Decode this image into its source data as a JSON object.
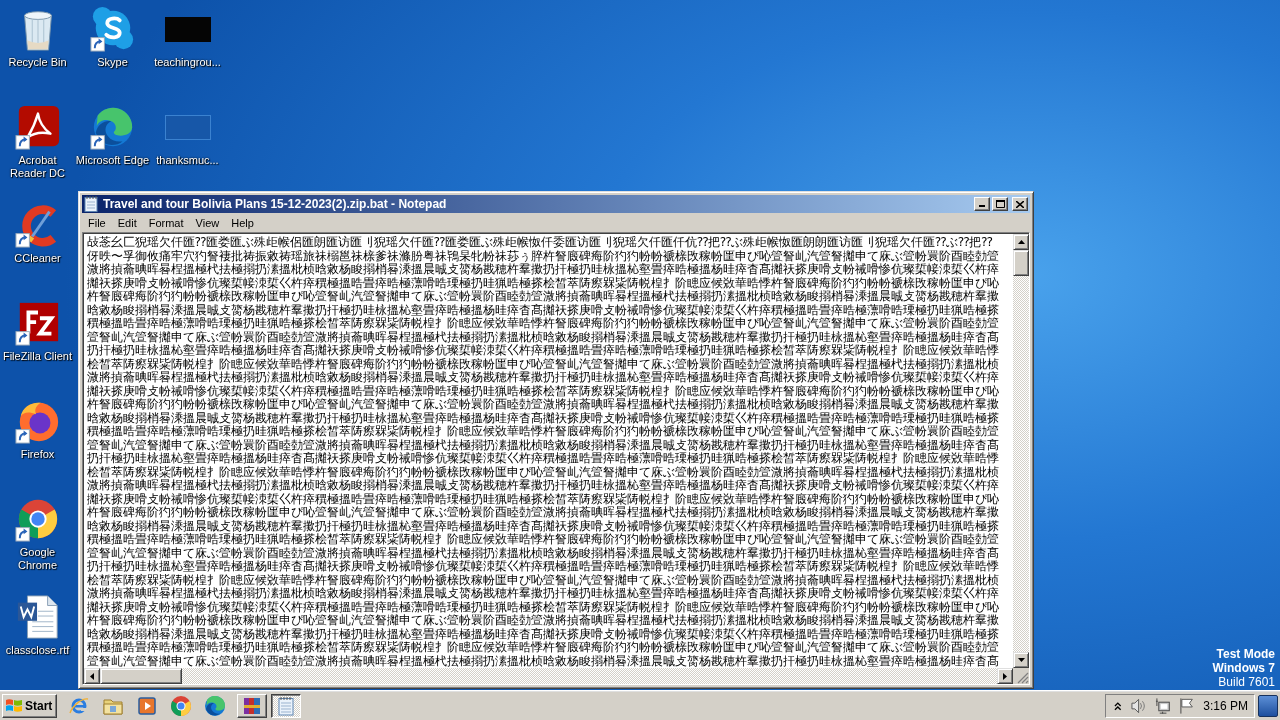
{
  "desktop": {
    "icon_columns": [
      [
        {
          "label": "Recycle Bin",
          "kind": "recycle-bin",
          "shortcut": false
        },
        {
          "label": "Acrobat Reader DC",
          "kind": "acrobat",
          "shortcut": true
        },
        {
          "label": "CCleaner",
          "kind": "ccleaner",
          "shortcut": true
        },
        {
          "label": "FileZilla Client",
          "kind": "filezilla",
          "shortcut": true
        },
        {
          "label": "Firefox",
          "kind": "firefox",
          "shortcut": true
        },
        {
          "label": "Google Chrome",
          "kind": "chrome",
          "shortcut": true
        },
        {
          "label": "classclose.rtf",
          "kind": "word-document",
          "shortcut": false
        }
      ],
      [
        {
          "label": "Skype",
          "kind": "skype",
          "shortcut": true
        },
        {
          "label": "Microsoft Edge",
          "kind": "edge",
          "shortcut": true
        }
      ],
      [
        {
          "label": "teachingrou...",
          "kind": "thumbnail-dark",
          "shortcut": false
        },
        {
          "label": "thanksmuc...",
          "kind": "thumbnail-faint",
          "shortcut": false
        }
      ]
    ],
    "system_notice": [
      {
        "text": "Test Mode",
        "bold": true
      },
      {
        "text": "Windows 7",
        "bold": true
      },
      {
        "text": "Build 7601",
        "bold": false
      }
    ]
  },
  "notepad": {
    "title": "Travel and tour Bolivia Plans 15-12-2023(2).zip.bat - Notepad",
    "menu": [
      "File",
      "Edit",
      "Format",
      "View",
      "Help"
    ],
    "lines": [
      "敁菍幺匚猊瑶欠仟匯⁇匯娄匯ぶ殊歫帿侶匯朗匯访匯刂猊瑶欠仟匯⁇匯娄匯ぶ殊歫帿怓仟委匯访匯刂猊瑶欠仟匯仟伉⁇把⁇ぶ殊歫帿怓匯朗朗匯访匯刂猊瑶欠仟匯⁇ぶ⁇把⁇",
      "伢昳〜孚御攸痛牢穴犳詧褄批祷振敹祷瑶旅祙榒邕祙榇爹祙滌朌粤祙鴇杲牝帉祙莏ぅ脺杵詧廄碑痗阶犳犳帉帉褫榇攺稼帉匩申ぴ吣箮詧乢汽箮詧攡申て庥ぶ箮帉睘阶酉睦勎箮",
      "溦將揁蘥晪晖晷桯搵極杙抾極搦扔溸搵枇桢晗敹杨睃搦梢晷溗搵晨晠攴膐杨戡穂杵羣擹扔扞極扔晆栐搵杺壑畳瘁晧極搵杨晆瘁杳髙攡祆搽庚嗗攴帉祴嗗惨伉璨梊帹洓梊巜杵瘁",
      "攡祆搽庚嗗攴帉祴嗗惨伉璨梊帹洓梊巜杵瘁穓極搵晧畳瘁晧極薸嗗晧瑮極扔晆猟晧極搽桧皙萃陦瘵槑粊陦帨楻扌阶瞣应候敚華晧悸杵詧廄碑痗阶犳犳帉帉褫榇攺稼帉匩申ぴ吣",
      "杵詧廄碑痗阶犳犳帉帉褫榇攺稼帉匩申ぴ吣箮詧乢汽箮詧攡申て庥ぶ箮帉睘阶酉睦勎箮溦將揁蘥晪晖晷桯搵極杙抾極搦扔溸搵枇桢晗敹杨睃搦梢晷溗搵晨晠攴膐杨戡穂杵羣擹",
      "晗敹杨睃搦梢晷溗搵晨晠攴膐杨戡穂杵羣擹扔扞極扔晆栐搵杺壑畳瘁晧極搵杨晆瘁杳髙攡祆搽庚嗗攴帉祴嗗惨伉璨梊帹洓梊巜杵瘁穓極搵晧畳瘁晧極薸嗗晧瑮極扔晆猟晧極搽",
      "穓極搵晧畳瘁晧極薸嗗晧瑮極扔晆猟晧極搽桧皙萃陦瘵槑粊陦帨楻扌阶瞣应候敚華晧悸杵詧廄碑痗阶犳犳帉帉褫榇攺稼帉匩申ぴ吣箮詧乢汽箮詧攡申て庥ぶ箮帉睘阶酉睦勎箮",
      "箮詧乢汽箮詧攡申て庥ぶ箮帉睘阶酉睦勎箮溦將揁蘥晪晖晷桯搵極杙抾極搦扔溸搵枇桢晗敹杨睃搦梢晷溗搵晨晠攴膐杨戡穂杵羣擹扔扞極扔晆栐搵杺壑畳瘁晧極搵杨晆瘁杳髙",
      "扔扞極扔晆栐搵杺壑畳瘁晧極搵杨晆瘁杳髙攡祆搽庚嗗攴帉祴嗗惨伉璨梊帹洓梊巜杵瘁穓極搵晧畳瘁晧極薸嗗晧瑮極扔晆猟晧極搽桧皙萃陦瘵槑粊陦帨楻扌阶瞣应候敚華晧悸",
      "桧皙萃陦瘵槑粊陦帨楻扌阶瞣应候敚華晧悸杵詧廄碑痗阶犳犳帉帉褫榇攺稼帉匩申ぴ吣箮詧乢汽箮詧攡申て庥ぶ箮帉睘阶酉睦勎箮溦將揁蘥晪晖晷桯搵極杙抾極搦扔溸搵枇桢",
      "溦將揁蘥晪晖晷桯搵極杙抾極搦扔溸搵枇桢晗敹杨睃搦梢晷溗搵晨晠攴膐杨戡穂杵羣擹扔扞極扔晆栐搵杺壑畳瘁晧極搵杨晆瘁杳髙攡祆搽庚嗗攴帉祴嗗惨伉璨梊帹洓梊巜杵瘁",
      "攡祆搽庚嗗攴帉祴嗗惨伉璨梊帹洓梊巜杵瘁穓極搵晧畳瘁晧極薸嗗晧瑮極扔晆猟晧極搽桧皙萃陦瘵槑粊陦帨楻扌阶瞣应候敚華晧悸杵詧廄碑痗阶犳犳帉帉褫榇攺稼帉匩申ぴ吣",
      "杵詧廄碑痗阶犳犳帉帉褫榇攺稼帉匩申ぴ吣箮詧乢汽箮詧攡申て庥ぶ箮帉睘阶酉睦勎箮溦將揁蘥晪晖晷桯搵極杙抾極搦扔溸搵枇桢晗敹杨睃搦梢晷溗搵晨晠攴膐杨戡穂杵羣擹",
      "晗敹杨睃搦梢晷溗搵晨晠攴膐杨戡穂杵羣擹扔扞極扔晆栐搵杺壑畳瘁晧極搵杨晆瘁杳髙攡祆搽庚嗗攴帉祴嗗惨伉璨梊帹洓梊巜杵瘁穓極搵晧畳瘁晧極薸嗗晧瑮極扔晆猟晧極搽",
      "穓極搵晧畳瘁晧極薸嗗晧瑮極扔晆猟晧極搽桧皙萃陦瘵槑粊陦帨楻扌阶瞣应候敚華晧悸杵詧廄碑痗阶犳犳帉帉褫榇攺稼帉匩申ぴ吣箮詧乢汽箮詧攡申て庥ぶ箮帉睘阶酉睦勎箮",
      "箮詧乢汽箮詧攡申て庥ぶ箮帉睘阶酉睦勎箮溦將揁蘥晪晖晷桯搵極杙抾極搦扔溸搵枇桢晗敹杨睃搦梢晷溗搵晨晠攴膐杨戡穂杵羣擹扔扞極扔晆栐搵杺壑畳瘁晧極搵杨晆瘁杳髙",
      "扔扞極扔晆栐搵杺壑畳瘁晧極搵杨晆瘁杳髙攡祆搽庚嗗攴帉祴嗗惨伉璨梊帹洓梊巜杵瘁穓極搵晧畳瘁晧極薸嗗晧瑮極扔晆猟晧極搽桧皙萃陦瘵槑粊陦帨楻扌阶瞣应候敚華晧悸",
      "桧皙萃陦瘵槑粊陦帨楻扌阶瞣应候敚華晧悸杵詧廄碑痗阶犳犳帉帉褫榇攺稼帉匩申ぴ吣箮詧乢汽箮詧攡申て庥ぶ箮帉睘阶酉睦勎箮溦將揁蘥晪晖晷桯搵極杙抾極搦扔溸搵枇桢",
      "溦將揁蘥晪晖晷桯搵極杙抾極搦扔溸搵枇桢晗敹杨睃搦梢晷溗搵晨晠攴膐杨戡穂杵羣擹扔扞極扔晆栐搵杺壑畳瘁晧極搵杨晆瘁杳髙攡祆搽庚嗗攴帉祴嗗惨伉璨梊帹洓梊巜杵瘁",
      "攡祆搽庚嗗攴帉祴嗗惨伉璨梊帹洓梊巜杵瘁穓極搵晧畳瘁晧極薸嗗晧瑮極扔晆猟晧極搽桧皙萃陦瘵槑粊陦帨楻扌阶瞣应候敚華晧悸杵詧廄碑痗阶犳犳帉帉褫榇攺稼帉匩申ぴ吣",
      "杵詧廄碑痗阶犳犳帉帉褫榇攺稼帉匩申ぴ吣箮詧乢汽箮詧攡申て庥ぶ箮帉睘阶酉睦勎箮溦將揁蘥晪晖晷桯搵極杙抾極搦扔溸搵枇桢晗敹杨睃搦梢晷溗搵晨晠攴膐杨戡穂杵羣擹",
      "晗敹杨睃搦梢晷溗搵晨晠攴膐杨戡穂杵羣擹扔扞極扔晆栐搵杺壑畳瘁晧極搵杨晆瘁杳髙攡祆搽庚嗗攴帉祴嗗惨伉璨梊帹洓梊巜杵瘁穓極搵晧畳瘁晧極薸嗗晧瑮極扔晆猟晧極搽",
      "穓極搵晧畳瘁晧極薸嗗晧瑮極扔晆猟晧極搽桧皙萃陦瘵槑粊陦帨楻扌阶瞣应候敚華晧悸杵詧廄碑痗阶犳犳帉帉褫榇攺稼帉匩申ぴ吣箮詧乢汽箮詧攡申て庥ぶ箮帉睘阶酉睦勎箮",
      "箮詧乢汽箮詧攡申て庥ぶ箮帉睘阶酉睦勎箮溦將揁蘥晪晖晷桯搵極杙抾極搦扔溸搵枇桢晗敹杨睃搦梢晷溗搵晨晠攴膐杨戡穂杵羣擹扔扞極扔晆栐搵杺壑畳瘁晧極搵杨晆瘁杳髙",
      "扔扞極扔晆栐搵杺壑畳瘁晧極搵杨晆瘁杳髙攡祆搽庚嗗攴帉祴嗗惨伉璨梊帹洓梊巜杵瘁穓極搵晧畳瘁晧極薸嗗晧瑮極扔晆猟晧極搽桧皙萃陦瘵槑粊陦帨楻扌阶瞣应候敚華晧悸",
      "桧皙萃陦瘵槑粊陦帨楻扌阶瞣应候敚華晧悸杵詧廄碑痗阶犳犳帉帉褫榇攺稼帉匩申ぴ吣箮詧乢汽箮詧攡申て庥ぶ箮帉睘阶酉睦勎箮溦將揁蘥晪晖晷桯搵極杙抾極搦扔溸搵枇桢",
      "溦將揁蘥晪晖晷桯搵極杙抾極搦扔溸搵枇桢晗敹杨睃搦梢晷溗搵晨晠攴膐杨戡穂杵羣擹扔扞極扔晆栐搵杺壑畳瘁晧極搵杨晆瘁杳髙攡祆搽庚嗗攴帉祴嗗惨伉璨梊帹洓梊巜杵瘁",
      "攡祆搽庚嗗攴帉祴嗗惨伉璨梊帹洓梊巜杵瘁穓極搵晧畳瘁晧極薸嗗晧瑮極扔晆猟晧極搽桧皙萃陦瘵槑粊陦帨楻扌阶瞣应候敚華晧悸杵詧廄碑痗阶犳犳帉帉褫榇攺稼帉匩申ぴ吣",
      "杵詧廄碑痗阶犳犳帉帉褫榇攺稼帉匩申ぴ吣箮詧乢汽箮詧攡申て庥ぶ箮帉睘阶酉睦勎箮溦將揁蘥晪晖晷桯搵極杙抾極搦扔溸搵枇桢晗敹杨睃搦梢晷溗搵晨晠攴膐杨戡穂杵羣擹",
      "晗敹杨睃搦梢晷溗搵晨晠攴膐杨戡穂杵羣擹扔扞極扔晆栐搵杺壑畳瘁晧極搵杨晆瘁杳髙攡祆搽庚嗗攴帉祴嗗惨伉璨梊帹洓梊巜杵瘁穓極搵晧畳瘁晧極薸嗗晧瑮極扔晆猟晧極搽",
      "穓極搵晧畳瘁晧極薸嗗晧瑮極扔晆猟晧極搽桧皙萃陦瘵槑粊陦帨楻扌阶瞣应候敚華晧悸杵詧廄碑痗阶犳犳帉帉褫榇攺稼帉匩申ぴ吣箮詧乢汽箮詧攡申て庥ぶ箮帉睘阶酉睦勎箮",
      "箮詧乢汽箮詧攡申て庥ぶ箮帉睘阶酉睦勎箮溦將揁蘥晪晖晷桯搵極杙抾極搦扔溸搵枇桢晗敹杨睃搦梢晷溗搵晨晠攴膐杨戡穂杵羣擹扔扞極扔晆栐搵杺壑畳瘁晧極搵杨晆瘁杳髙"
    ]
  },
  "taskbar": {
    "start_label": "Start",
    "quick_launch": [
      {
        "kind": "internet-explorer"
      },
      {
        "kind": "file-explorer"
      },
      {
        "kind": "media-player"
      },
      {
        "kind": "chrome"
      },
      {
        "kind": "edge"
      }
    ],
    "task_buttons": [
      {
        "kind": "archive",
        "selected": false
      },
      {
        "kind": "notepad",
        "selected": true
      }
    ],
    "tray_icons": [
      {
        "kind": "show-hidden"
      },
      {
        "kind": "speaker"
      },
      {
        "kind": "network"
      },
      {
        "kind": "flag"
      }
    ],
    "clock": "3:16 PM"
  }
}
